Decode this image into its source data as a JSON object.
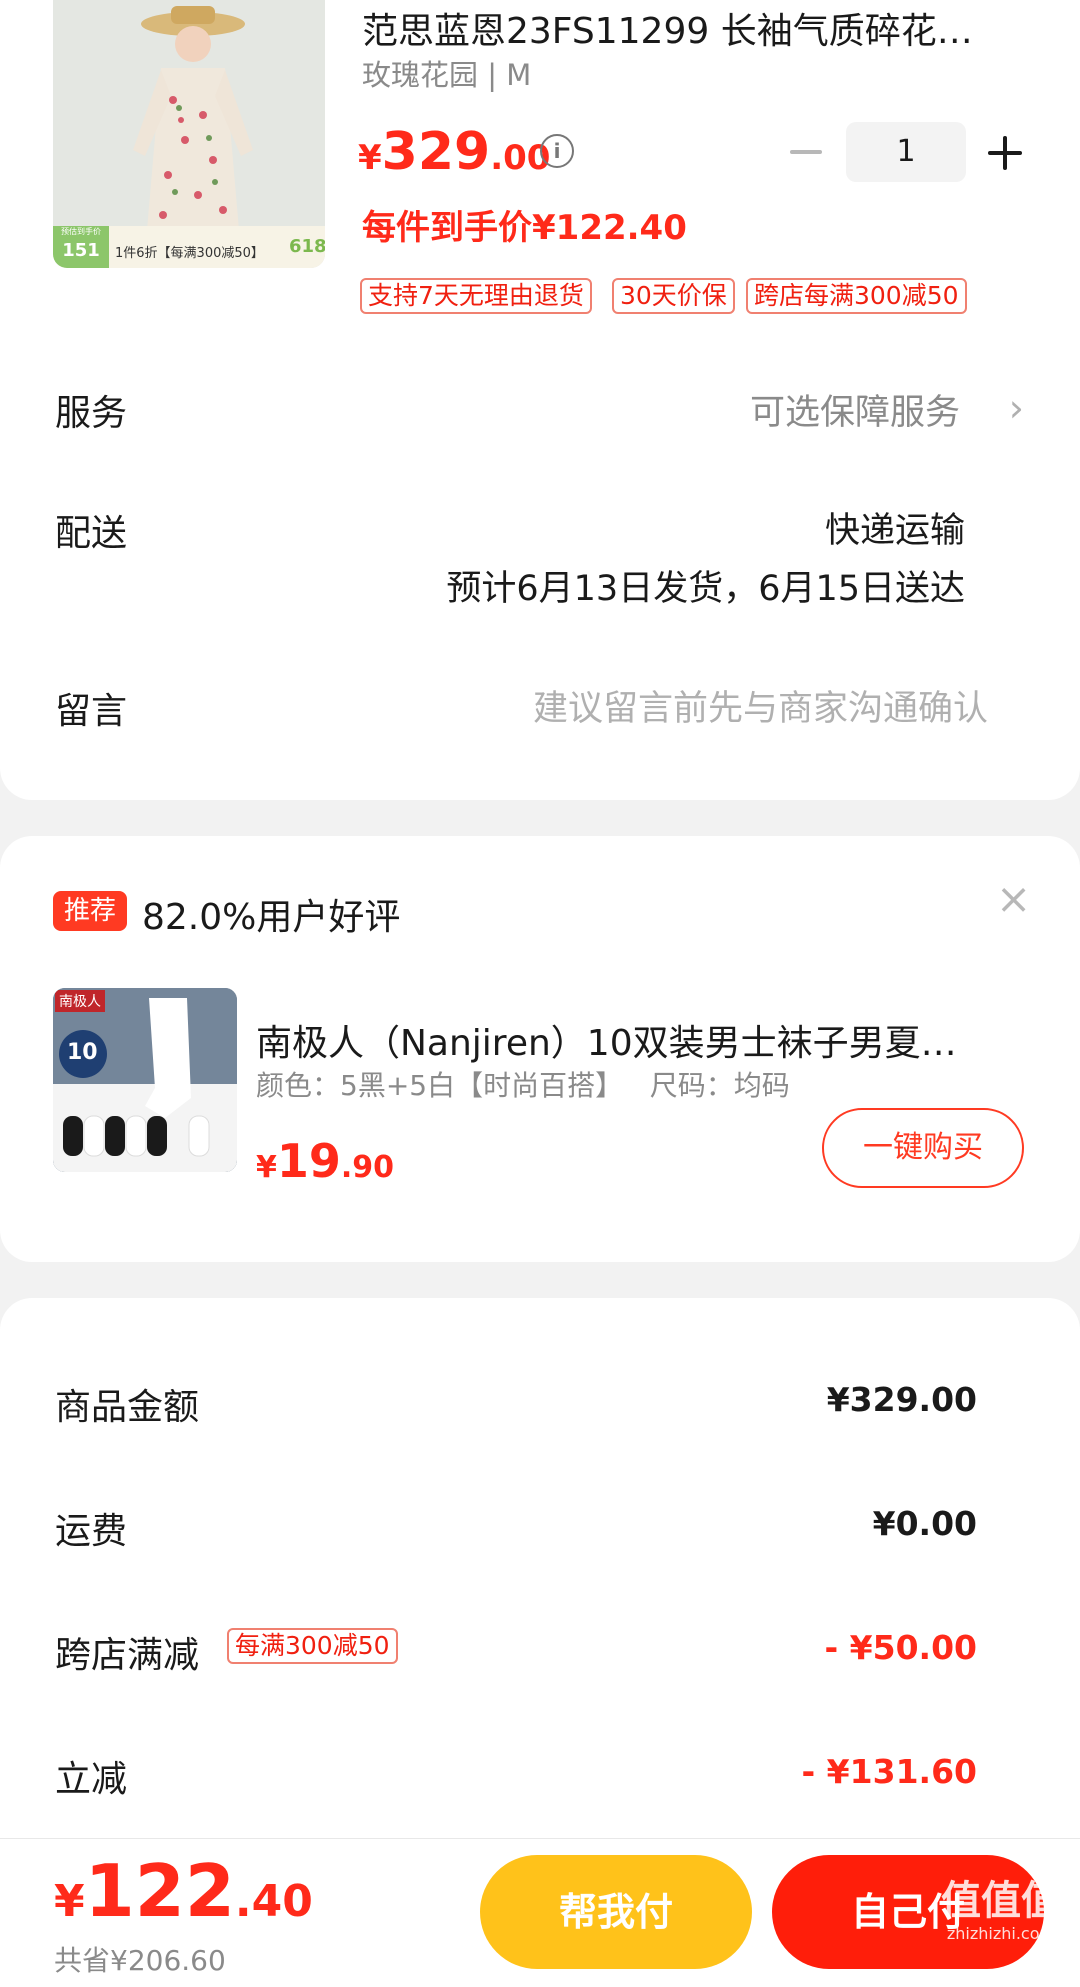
{
  "product": {
    "title": "范思蓝恩23FS11299 长袖气质碎花…",
    "variant": "玫瑰花园 | M",
    "price_currency": "¥",
    "price_int": "329",
    "price_dec": ".00",
    "each_price": "每件到手价¥122.40",
    "quantity": "1",
    "image_badge_left": "151",
    "image_badge_left_label": "预估到手价",
    "image_badge_text": "1件6折【每满300减50】",
    "image_badge_right": "618",
    "tags": [
      "支持7天无理由退货",
      "30天价保",
      "跨店每满300减50"
    ]
  },
  "service": {
    "label": "服务",
    "value": "可选保障服务"
  },
  "delivery": {
    "label": "配送",
    "method": "快递运输",
    "eta": "预计6月13日发货，6月15日送达"
  },
  "note": {
    "label": "留言",
    "placeholder": "建议留言前先与商家沟通确认"
  },
  "recommend": {
    "badge": "推荐",
    "headline": "82.0%用户好评",
    "brand_label": "南极人",
    "pack_count": "10",
    "title": "南极人（Nanjiren）10双装男士袜子男夏…",
    "spec": "颜色：5黑+5白【时尚百搭】   尺码：均码",
    "price_currency": "¥",
    "price_int": "19",
    "price_dec": ".90",
    "buy_button": "一键购买"
  },
  "summary": {
    "rows": [
      {
        "label": "商品金额",
        "value": "¥329.00"
      },
      {
        "label": "运费",
        "value": "¥0.00"
      },
      {
        "label": "跨店满减",
        "tag": "每满300减50",
        "value": "- ¥50.00"
      },
      {
        "label": "立减",
        "value": "- ¥131.60"
      }
    ]
  },
  "footer": {
    "total_currency": "¥",
    "total_int": "122",
    "total_dec": ".40",
    "saved": "共省¥206.60",
    "help_pay": "帮我付",
    "self_pay": "自己付",
    "watermark": "值值值",
    "watermark_url": "zhizhizhi.com"
  },
  "colors": {
    "accent": "#ff2a1a",
    "help_pay": "#ffc21a",
    "self_pay": "#ff1e0a"
  }
}
